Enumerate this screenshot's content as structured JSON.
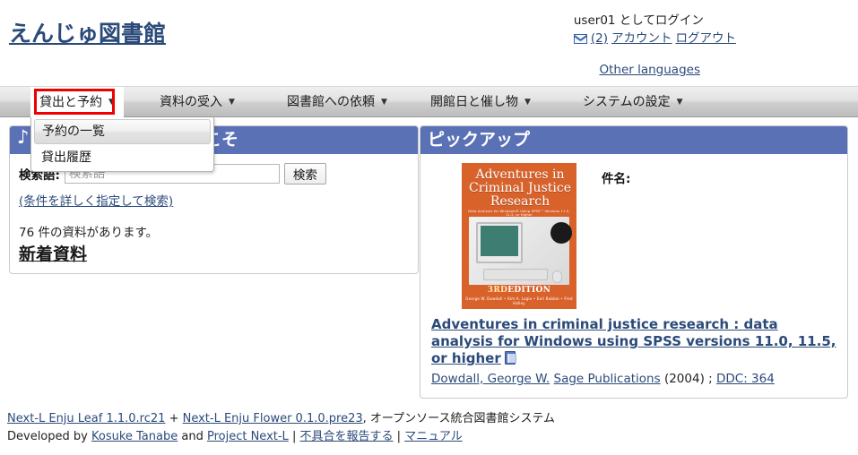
{
  "header": {
    "site_title": "えんじゅ図書館",
    "login_prefix": "user01",
    "login_suffix": " としてログイン",
    "mail_icon": "envelope-icon",
    "message_count": "(2)",
    "account_link": "アカウント",
    "logout_link": "ログアウト",
    "other_languages": "Other languages"
  },
  "nav": {
    "caret": "▼",
    "items": [
      {
        "label": "貸出と予約"
      },
      {
        "label": "資料の受入"
      },
      {
        "label": "図書館への依頼"
      },
      {
        "label": "開館日と催し物"
      },
      {
        "label": "システムの設定"
      }
    ]
  },
  "dropdown": {
    "open_for": "貸出と予約",
    "items": [
      {
        "label": "予約の一覧",
        "active": true
      },
      {
        "label": "貸出履歴",
        "active": false
      }
    ]
  },
  "left_panel": {
    "title": "えんじゅ図書館へようこそ",
    "note_icon": "music-note-icon",
    "search_label": "検索語:",
    "search_value": "",
    "search_placeholder": "検索語",
    "search_button": "検索",
    "advanced_search": "(条件を詳しく指定して検索)",
    "count_line": "76 件の資料があります。",
    "new_arrivals": "新着資料"
  },
  "pickup": {
    "title": "ピックアップ",
    "subject_label": "件名:",
    "cover": {
      "alt": "book-cover-image",
      "line1": "Adventures in",
      "line2": "Criminal Justice",
      "line3": "Research",
      "subtitle": "Data Analysis for Windows® Using SPSS™ Versions 11.0, 11.5, or Higher",
      "edition_num": "3RD",
      "edition_word": "EDITION",
      "authors": "George W. Dowdall  •  Kim A. Logio  •  Earl Babbie  •  Fred Halley"
    },
    "book_title": "Adventures in criminal justice research : data analysis for Windows using SPSS versions 11.0, 11.5, or higher",
    "book_icon": "book-icon",
    "author": "Dowdall, George W.",
    "publisher": "Sage Publications",
    "year": "(2004) ;",
    "classification": "DDC: 364"
  },
  "footer": {
    "leaf": "Next-L Enju Leaf 1.1.0.rc21",
    "plus": " + ",
    "flower": "Next-L Enju Flower 0.1.0.pre23",
    "tagline": ", オープンソース統合図書館システム",
    "developed_by": "Developed by ",
    "dev1": "Kosuke Tanabe",
    "and": " and ",
    "dev2": "Project Next-L",
    "sep1": " | ",
    "bug": "不具合を報告する",
    "sep2": " | ",
    "manual": "マニュアル"
  },
  "colors": {
    "panel_header": "#5a72b5",
    "link": "#2b4a7a",
    "highlight_box": "#ee0000",
    "cover_bg": "#d9622b"
  }
}
